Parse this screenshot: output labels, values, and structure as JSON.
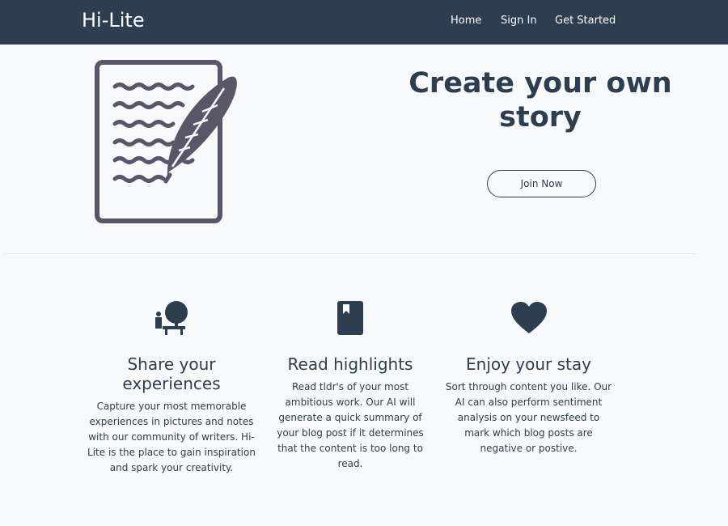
{
  "navbar": {
    "brand": "Hi-Lite",
    "links": [
      "Home",
      "Sign In",
      "Get Started"
    ]
  },
  "hero": {
    "title": "Create your own story",
    "button_label": "Join Now",
    "illustration": "document-quill-icon"
  },
  "features": [
    {
      "icon": "person-tree-icon",
      "title": "Share your experiences",
      "text": "Capture your most memorable experiences in pictures and notes with our community of writers. Hi-Lite is the place to gain inspiration and spark your creativity."
    },
    {
      "icon": "bookmark-book-icon",
      "title": "Read highlights",
      "text": "Read tldr's of your most ambitious work. Our AI will generate a quick summary of your blog post if it determines that the content is too long to read."
    },
    {
      "icon": "heart-icon",
      "title": "Enjoy your stay",
      "text": "Sort through content you like. Our AI can also perform sentiment analysis on your newsfeed to mark which blog posts are negative or postive."
    }
  ],
  "colors": {
    "navbar_bg": "#2c3e50",
    "page_bg": "#f8f9fa",
    "text": "#2c3e50",
    "illustration": "#5a5669"
  }
}
